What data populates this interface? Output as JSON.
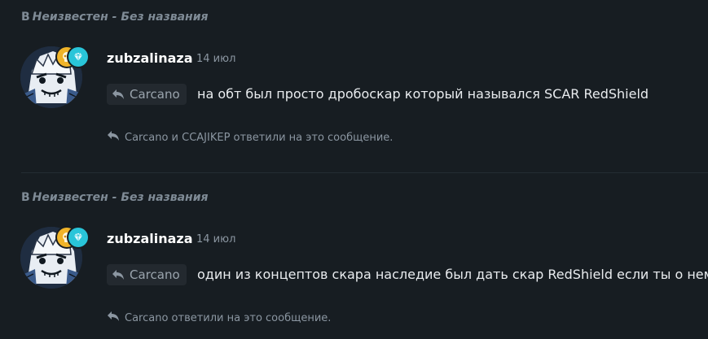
{
  "colors": {
    "background": "#171d22",
    "badge_gold": "#f0b429",
    "badge_cyan": "#29c5d9",
    "muted": "#8b96a1"
  },
  "posts": [
    {
      "context_prefix": "В",
      "context_location": "Неизвестен - Без названия",
      "author": "zubzalinaza",
      "time": "14 июл",
      "reply_to": "Carcano",
      "text": "на обт был просто дробоскар который назывался SCAR RedShield",
      "replies_text": "Carcano и CCAJIKEP ответили на это сообщение."
    },
    {
      "context_prefix": "В",
      "context_location": "Неизвестен - Без названия",
      "author": "zubzalinaza",
      "time": "14 июл",
      "reply_to": "Carcano",
      "text": "один из концептов скара наследие был дать скар RedShield если ты о нем",
      "replies_text": "Carcano ответили на это сообщение."
    }
  ]
}
